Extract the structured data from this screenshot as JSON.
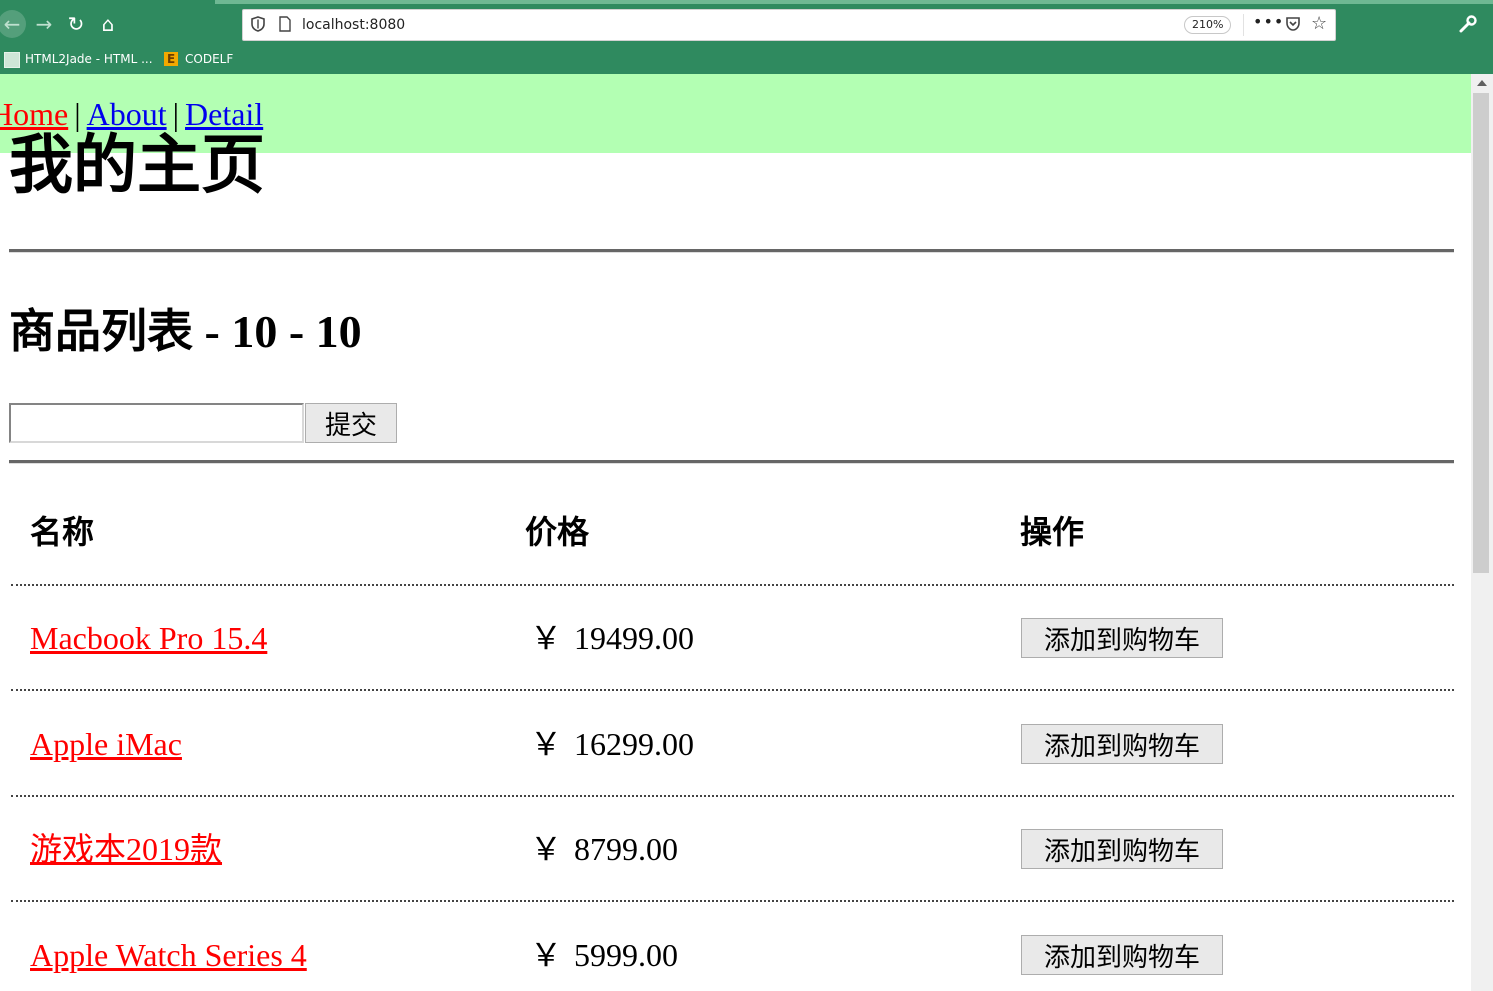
{
  "browser": {
    "url": "localhost:8080",
    "zoom": "210%",
    "bookmarks": [
      {
        "label": "HTML2Jade - HTML ..."
      },
      {
        "label": "CODELF"
      }
    ]
  },
  "nav": {
    "home": "Home",
    "about": "About",
    "detail": "Detail",
    "separator": "|"
  },
  "page": {
    "title": "我的主页",
    "list_title_prefix": "商品列表",
    "list_title_suffix": " - 10 - 10",
    "search_value": "",
    "submit_label": "提交"
  },
  "table": {
    "headers": [
      "名称",
      "价格",
      "操作"
    ],
    "rows": [
      {
        "name": "Macbook Pro 15.4",
        "currency": "￥",
        "price": "19499.00",
        "action": "添加到购物车"
      },
      {
        "name": "Apple iMac",
        "currency": "￥",
        "price": "16299.00",
        "action": "添加到购物车"
      },
      {
        "name": "游戏本2019款",
        "currency": "￥",
        "price": "8799.00",
        "action": "添加到购物车"
      },
      {
        "name": "Apple Watch Series 4",
        "currency": "￥",
        "price": "5999.00",
        "action": "添加到购物车"
      }
    ]
  },
  "colors": {
    "chrome": "#2f8a5f",
    "nav_bg": "#b3ffb3",
    "link_active": "#ff0000",
    "link": "#0000ee"
  }
}
